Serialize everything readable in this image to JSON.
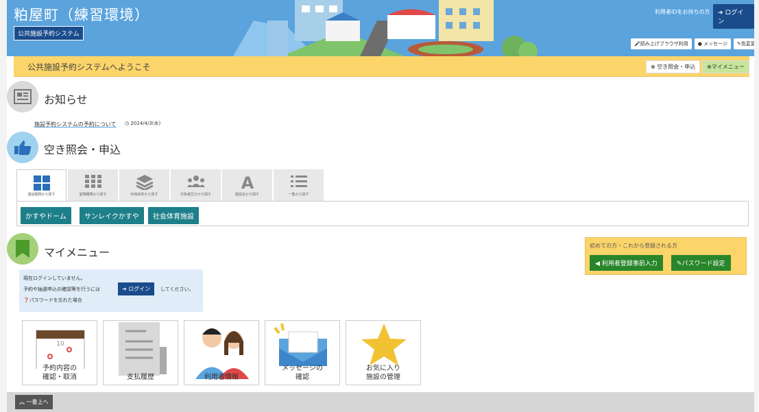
{
  "header": {
    "title": "粕屋町（練習環境）",
    "badge": "公共施設予約システム",
    "login_note": "利用者IDをお持ちの方",
    "login_btn": "ログイン",
    "tools": [
      {
        "label": "読み上げブラウザ利用"
      },
      {
        "label": "メッセージ"
      },
      {
        "label": "色変更"
      }
    ]
  },
  "welcome": {
    "text": "公共施設予約システムへようこそ",
    "btn_search": "空き照会・申込",
    "btn_mymenu": "マイメニュー"
  },
  "news": {
    "title": "お知らせ",
    "link": "施設予約システムの予約について",
    "date": "2024/4/3(水)"
  },
  "search": {
    "title": "空き照会・申込",
    "tabs": [
      {
        "label": "施設種類から探す",
        "icon": "grid-icon"
      },
      {
        "label": "室場種類から探す",
        "icon": "small-grid-icon"
      },
      {
        "label": "利用目的から探す",
        "icon": "layers-icon"
      },
      {
        "label": "対象者区分から探す",
        "icon": "people-icon"
      },
      {
        "label": "施設名から探す",
        "icon": "letter-a-icon"
      },
      {
        "label": "一覧から探す",
        "icon": "list-icon"
      }
    ],
    "facilities": [
      {
        "label": "かすやドーム"
      },
      {
        "label": "サンレイクかすや"
      },
      {
        "label": "社会体育施設"
      }
    ]
  },
  "mymenu": {
    "title": "マイメニュー",
    "first_box": {
      "title": "初めての方・これから登録される方",
      "btn_register": "利用者登録事前入力",
      "btn_password": "パスワード設定"
    },
    "login_info": {
      "line1": "現在ログインしていません。",
      "line2": "予約や抽選申込の確認等を行うには",
      "btn": "ログイン",
      "line2b": "してください。",
      "forgot": "パスワードを忘れた場合"
    },
    "cards": [
      {
        "line1": "予約内容の",
        "line2": "確認・取消"
      },
      {
        "line1": "",
        "line2": "支払履歴"
      },
      {
        "line1": "",
        "line2": "利用者情報"
      },
      {
        "line1": "メッセージの",
        "line2": "確認"
      },
      {
        "line1": "お気に入り",
        "line2": "施設の管理"
      }
    ]
  },
  "footer": {
    "top_btn": "一番上へ"
  },
  "colors": {
    "header_blue": "#5aa3dd",
    "navy": "#1a4c8c",
    "yellow": "#fbd46a",
    "teal": "#1d7f89",
    "green": "#29852a"
  }
}
